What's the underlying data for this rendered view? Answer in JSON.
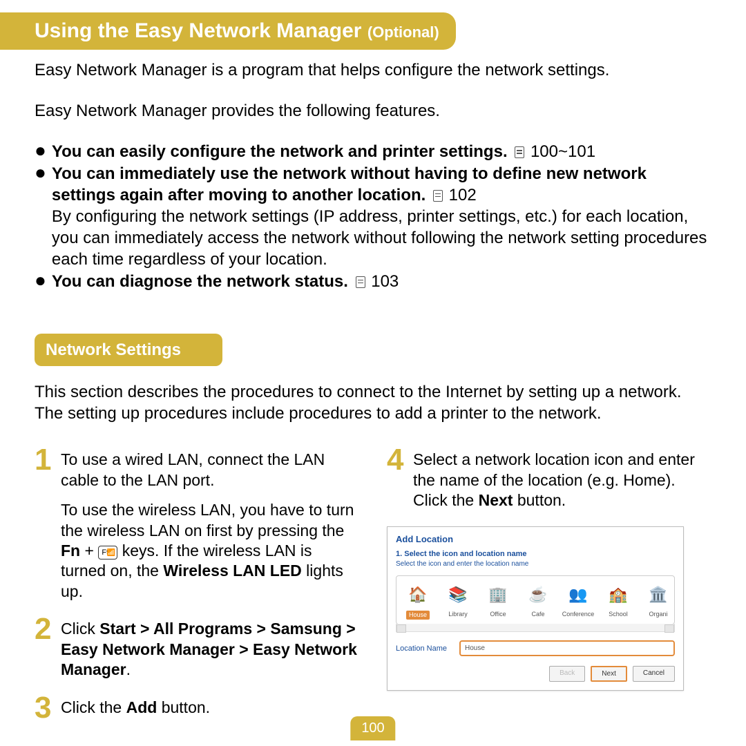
{
  "header": {
    "title": "Using the Easy Network Manager",
    "optional": "(Optional)"
  },
  "intro1": "Easy Network Manager is a program that helps configure the network settings.",
  "intro2": "Easy Network Manager provides the following features.",
  "features": {
    "f1_bold": "You can easily configure the network and printer settings.",
    "f1_ref": " 100~101",
    "f2_bold": "You can immediately use the network without having to define new network settings again after moving to another location.",
    "f2_ref": " 102",
    "f2_body": "By configuring the network settings (IP address, printer settings, etc.) for each location, you can immediately access the network without following the network setting procedures each time regardless of your location.",
    "f3_bold": "You can diagnose the network status.",
    "f3_ref": " 103"
  },
  "subheading": "Network Settings",
  "section_text": "This section describes the procedures to connect to the Internet by setting up a network. The setting up procedures include procedures to add a printer to the network.",
  "steps": {
    "s1_a": "To use a wired LAN, connect the LAN cable to the LAN port.",
    "s1_b_pre": "To use the wireless LAN, you have to turn the wireless LAN on first by pressing the ",
    "s1_b_fn": "Fn",
    "s1_b_plus": " + ",
    "s1_b_key": "F9",
    "s1_b_post": " keys. If the wireless LAN is turned on, the ",
    "s1_b_led": "Wireless LAN LED",
    "s1_b_end": " lights up.",
    "s2_pre": "Click ",
    "s2_bold": "Start > All Programs > Samsung > Easy Network Manager > Easy Network Manager",
    "s2_end": ".",
    "s3_pre": "Click the ",
    "s3_bold": "Add",
    "s3_end": " button.",
    "s4_pre": "Select a network location icon and enter the name of the location (e.g. Home). Click the ",
    "s4_bold": "Next",
    "s4_end": " button."
  },
  "dialog": {
    "title": "Add Location",
    "step": "1. Select the icon and location name",
    "sub": "Select the icon and enter the location name",
    "locations": [
      "House",
      "Library",
      "Office",
      "Cafe",
      "Conference",
      "School",
      "Organi"
    ],
    "field_label": "Location Name",
    "field_value": "House",
    "btn_back": "Back",
    "btn_next": "Next",
    "btn_cancel": "Cancel"
  },
  "page_number": "100"
}
